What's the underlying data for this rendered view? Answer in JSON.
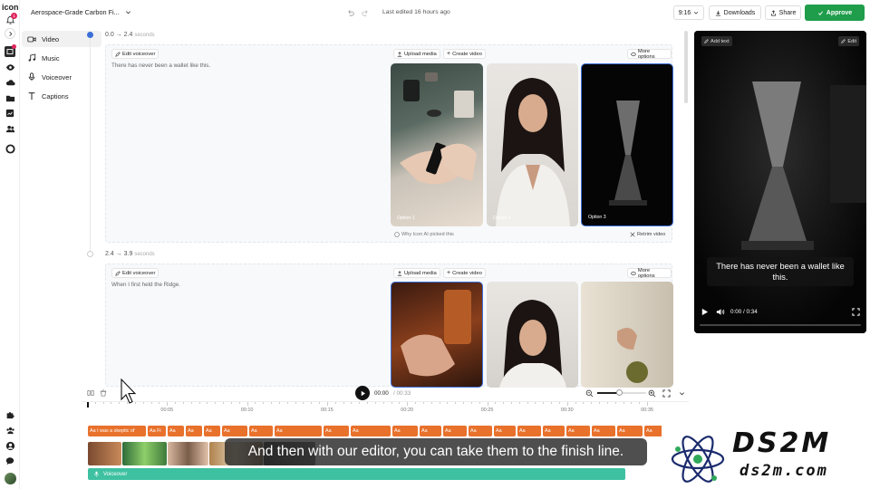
{
  "app": {
    "logo": "icon",
    "notification_count": "1"
  },
  "rail_icons": [
    "bell-icon",
    "chevron-right-icon",
    "edit-icon",
    "eye-icon",
    "cloud-icon",
    "folder-icon",
    "chart-icon",
    "users-icon",
    "circle-icon"
  ],
  "rail_bottom_icons": [
    "puzzle-icon",
    "team-icon",
    "account-icon",
    "chat-icon",
    "avatar"
  ],
  "nav": [
    {
      "label": "Video",
      "icon": "video-icon",
      "active": true
    },
    {
      "label": "Music",
      "icon": "music-icon"
    },
    {
      "label": "Voiceover",
      "icon": "mic-icon"
    },
    {
      "label": "Captions",
      "icon": "text-icon"
    }
  ],
  "topbar": {
    "project_title": "Aerospace-Grade Carbon Fi...",
    "last_edited": "Last edited 16 hours ago",
    "aspect": "9:16",
    "downloads": "Downloads",
    "share": "Share",
    "approve": "Approve"
  },
  "scenes": [
    {
      "start": "0.0",
      "end": "2.4",
      "unit": "seconds",
      "edit_voiceover": "Edit voiceover",
      "upload_media": "Upload media",
      "create_video": "Create video",
      "more_options": "More options",
      "line": "There has never been a wallet like this.",
      "options": [
        "Option 1",
        "Option 2",
        "Option 3"
      ],
      "why_picked": "Why Icon AI picked this",
      "retrim": "Retrim video"
    },
    {
      "start": "2.4",
      "end": "3.9",
      "unit": "seconds",
      "edit_voiceover": "Edit voiceover",
      "upload_media": "Upload media",
      "create_video": "Create video",
      "more_options": "More options",
      "line": "When I first held the Ridge."
    }
  ],
  "player": {
    "add_text": "Add text",
    "edit": "Edit",
    "caption": "There has never been a wallet like this.",
    "time": "0:00 / 0:34",
    "progress": 0.0
  },
  "timeline": {
    "current": "00:00",
    "total": "00:33",
    "zoom": 0.45,
    "ticks": [
      "00:05",
      "00:10",
      "00:15",
      "00:20",
      "00:25",
      "00:30",
      "00:35"
    ],
    "caption_chips": [
      "I was a skeptic of",
      "Fi",
      "",
      "",
      "",
      "",
      "",
      "",
      "",
      "",
      "",
      "",
      "",
      "",
      "",
      "",
      "",
      "",
      "",
      "",
      ""
    ],
    "chip_prefix": "Aa",
    "voiceover_label": "Voiceover"
  },
  "subtitle": "And then with our editor, you can take them to the finish line.",
  "watermark": {
    "line1": "DS2M",
    "line2": "ds2m.com"
  },
  "colors": {
    "accent_green": "#1f9d4a",
    "caption_orange": "#e8712c",
    "voiceover_teal": "#3ec1a1",
    "selected_blue": "#3b6fd8",
    "badge_red": "#e0245e"
  }
}
